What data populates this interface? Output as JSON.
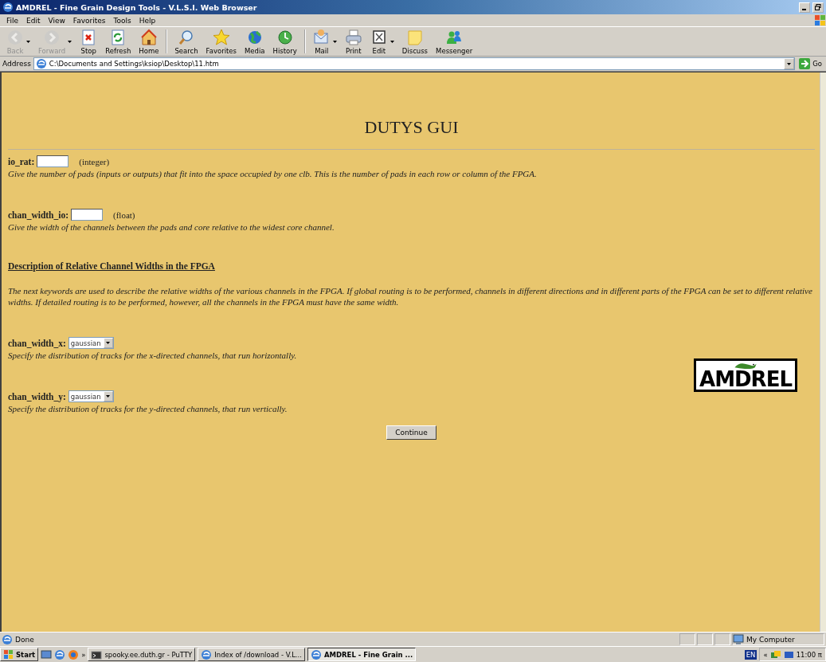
{
  "window": {
    "title": "AMDREL - Fine Grain Design Tools - V.L.S.I. Web Browser"
  },
  "menu": [
    "File",
    "Edit",
    "View",
    "Favorites",
    "Tools",
    "Help"
  ],
  "toolbar": [
    {
      "kind": "back",
      "label": "Back",
      "disabled": true,
      "dropdown": true
    },
    {
      "kind": "forward",
      "label": "Forward",
      "disabled": true,
      "dropdown": true
    },
    {
      "kind": "stop",
      "label": "Stop",
      "disabled": false,
      "dropdown": false
    },
    {
      "kind": "refresh",
      "label": "Refresh",
      "disabled": false,
      "dropdown": false
    },
    {
      "kind": "home",
      "label": "Home",
      "disabled": false,
      "dropdown": false
    },
    {
      "kind": "separator"
    },
    {
      "kind": "search",
      "label": "Search",
      "disabled": false,
      "dropdown": false
    },
    {
      "kind": "favorites",
      "label": "Favorites",
      "disabled": false,
      "dropdown": false
    },
    {
      "kind": "media",
      "label": "Media",
      "disabled": false,
      "dropdown": false
    },
    {
      "kind": "history",
      "label": "History",
      "disabled": false,
      "dropdown": false
    },
    {
      "kind": "separator"
    },
    {
      "kind": "mail",
      "label": "Mail",
      "disabled": false,
      "dropdown": true
    },
    {
      "kind": "print",
      "label": "Print",
      "disabled": false,
      "dropdown": false
    },
    {
      "kind": "edit",
      "label": "Edit",
      "disabled": false,
      "dropdown": true
    },
    {
      "kind": "discuss",
      "label": "Discuss",
      "disabled": false,
      "dropdown": false
    },
    {
      "kind": "messenger",
      "label": "Messenger",
      "disabled": false,
      "dropdown": false
    }
  ],
  "address": {
    "label": "Address",
    "value": "C:\\Documents and Settings\\ksiop\\Desktop\\11.htm",
    "go": "Go"
  },
  "page": {
    "heading": "DUTYS GUI",
    "blocks": [
      {
        "kind": "input",
        "label": "io_rat:",
        "hint": "(integer)",
        "description": "Give the number of pads (inputs or outputs) that fit into the space occupied by one clb. This is the number of pads in each row or column of the FPGA."
      },
      {
        "kind": "input",
        "label": "chan_width_io:",
        "hint": "(float)",
        "description": "Give the width of the channels between the pads and core relative to the widest core channel."
      },
      {
        "kind": "section",
        "text": "Description of Relative Channel Widths in the FPGA"
      },
      {
        "kind": "paragraph",
        "text": "The next keywords are used to describe the relative widths of the various channels in the FPGA. If global routing is to be performed, channels in different directions and in different parts of the FPGA can be set to different relative widths. If detailed routing is to be performed, however, all the channels in the FPGA must have the same width."
      },
      {
        "kind": "select",
        "label": "chan_width_x:",
        "value": "gaussian",
        "description": "Specify the distribution of tracks for the x-directed channels, that run horizontally."
      },
      {
        "kind": "select",
        "label": "chan_width_y:",
        "value": "gaussian",
        "description": "Specify the distribution of tracks for the y-directed channels, that run vertically."
      }
    ],
    "logo": "AMDREL",
    "button": "Continue"
  },
  "status": {
    "text": "Done",
    "zone": "My Computer"
  },
  "taskbar": {
    "start": "Start",
    "more": "»",
    "tasks": [
      {
        "label": "spooky.ee.duth.gr - PuTTY",
        "kind": "putty",
        "selected": false
      },
      {
        "label": "Index of /download - V.L...",
        "kind": "browser",
        "selected": false
      },
      {
        "label": "AMDREL - Fine Grain ...",
        "kind": "browser",
        "selected": true
      }
    ],
    "language": "EN",
    "tray_more": "«",
    "clock": "11:00 π"
  }
}
